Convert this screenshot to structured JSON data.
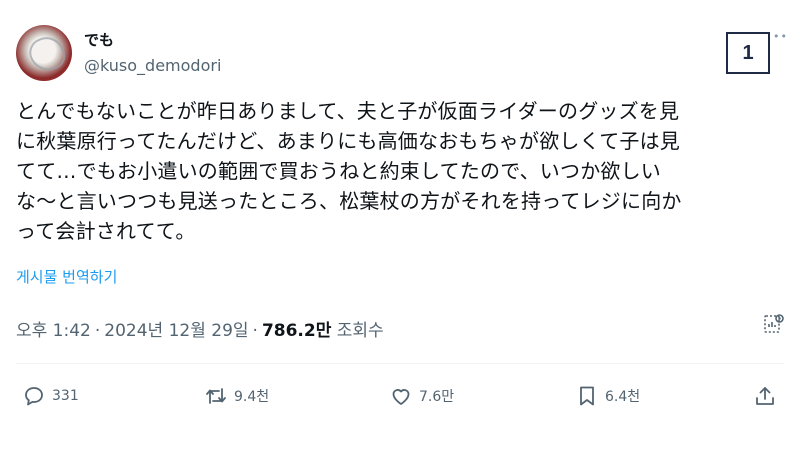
{
  "author": {
    "display_name": "でも",
    "handle": "@kuso_demodori"
  },
  "badge_number": "1",
  "more_icon": "more-dots-icon",
  "tweet": {
    "lines": [
      "とんでもないことが昨日ありまして、夫と子が仮面ライダーのグッズを見",
      "に秋葉原行ってたんだけど、あまりにも高価なおもちゃが欲しくて子は見",
      "てて…でもお小遣いの範囲で買おうねと約束してたので、いつか欲しい",
      "な〜と言いつつも見送ったところ、松葉杖の方がそれを持ってレジに向か",
      "って会計されてて。"
    ],
    "translate_label": "게시물 번역하기"
  },
  "meta": {
    "time": "오후 1:42",
    "dot": "·",
    "date": "2024년 12월 29일",
    "views": "786.2만",
    "views_label": "조회수"
  },
  "actions": {
    "reply_count": "331",
    "retweet_count": "9.4천",
    "like_count": "7.6만",
    "bookmark_count": "6.4천"
  },
  "colors": {
    "text": "#0f1419",
    "secondary": "#536471",
    "link": "#1d9bf0",
    "badge_border": "#1f2a44"
  }
}
